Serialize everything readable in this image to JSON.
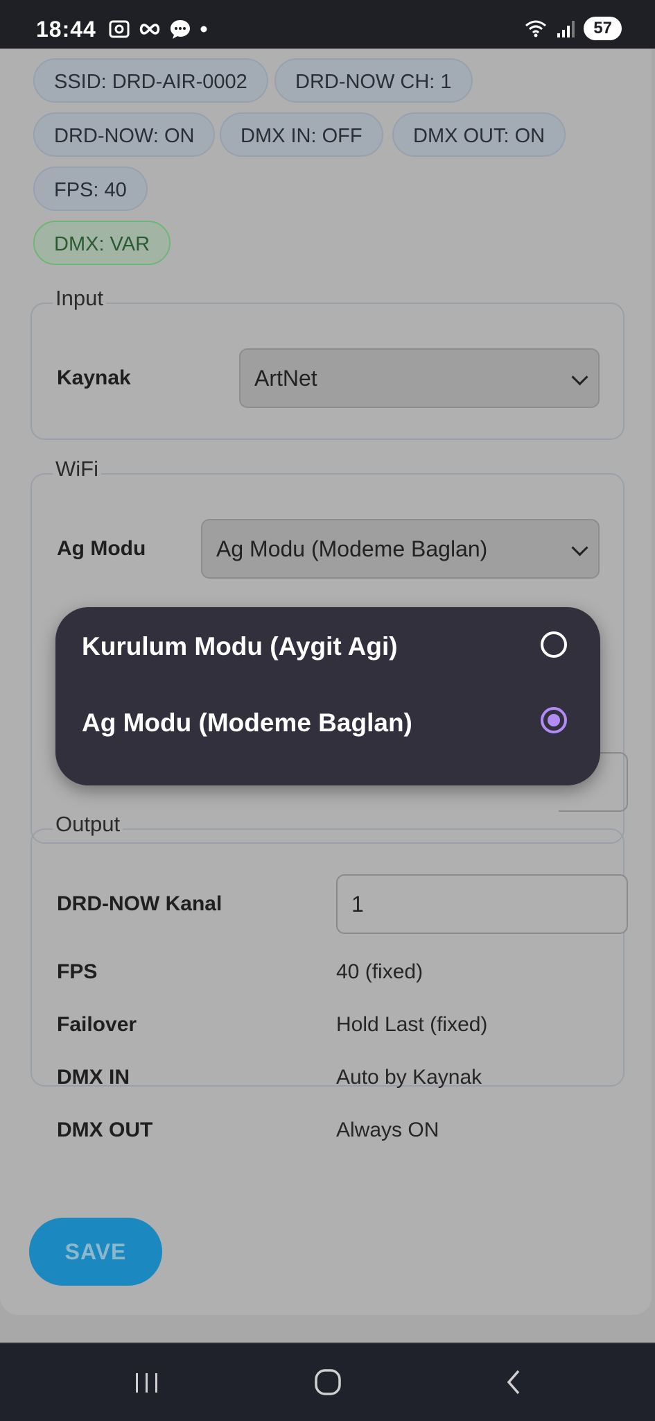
{
  "status_bar": {
    "time": "18:44",
    "battery": "57"
  },
  "chips": [
    {
      "text": "SSID: DRD-AIR-0002"
    },
    {
      "text": "DRD-NOW CH: 1"
    },
    {
      "text": "DRD-NOW: ON"
    },
    {
      "text": "DMX IN: OFF"
    },
    {
      "text": "DMX OUT: ON"
    },
    {
      "text": "FPS: 40"
    },
    {
      "text": "DMX: VAR"
    }
  ],
  "input_section": {
    "legend": "Input",
    "source_label": "Kaynak",
    "source_value": "ArtNet"
  },
  "wifi_section": {
    "legend": "WiFi",
    "mode_label": "Ag Modu",
    "mode_value": "Ag Modu (Modeme Baglan)"
  },
  "output_section": {
    "legend": "Output",
    "channel_label": "DRD-NOW Kanal",
    "channel_value": "1",
    "rows": [
      {
        "label": "FPS",
        "value": "40 (fixed)"
      },
      {
        "label": "Failover",
        "value": "Hold Last (fixed)"
      },
      {
        "label": "DMX IN",
        "value": "Auto by Kaynak"
      },
      {
        "label": "DMX OUT",
        "value": "Always ON"
      }
    ]
  },
  "save_button": {
    "label": "SAVE"
  },
  "popup": {
    "options": [
      {
        "label": "Kurulum Modu (Aygit Agi)",
        "selected": false
      },
      {
        "label": "Ag Modu (Modeme Baglan)",
        "selected": true
      }
    ]
  },
  "colors": {
    "accent": "#1b88bf",
    "radio_selected": "#b28cf5",
    "popup_bg": "#32303c"
  }
}
